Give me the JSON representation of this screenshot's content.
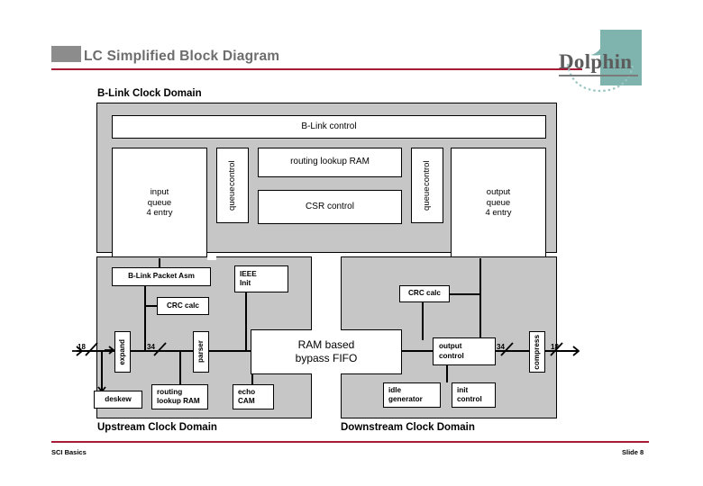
{
  "header": {
    "title": "LC Simplified Block Diagram",
    "bullet_color": "#8c8c8c",
    "rule_color": "#a81b37",
    "title_color": "#6d6d6d"
  },
  "logo": {
    "text": "Dolphin",
    "square_color": "#7fb3ae",
    "dolphin_icon": "dolphin-icon"
  },
  "diagram": {
    "blink_domain_label": "B-Link Clock Domain",
    "upstream_label": "Upstream Clock Domain",
    "downstream_label": "Downstream Clock Domain",
    "blocks": {
      "blink_control": "B-Link control",
      "input_queue": "input\nqueue\n4 entry",
      "input_queue_l1": "input",
      "input_queue_l2": "queue",
      "input_queue_l3": "4 entry",
      "queue_control_left": "queue\ncontrol",
      "queue_control_left_l1": "queue",
      "queue_control_left_l2": "control",
      "routing_lookup_ram_top": "routing lookup RAM",
      "csr_control": "CSR control",
      "queue_control_right_l1": "queue",
      "queue_control_right_l2": "control",
      "output_queue_l1": "output",
      "output_queue_l2": "queue",
      "output_queue_l3": "4 entry",
      "blink_packet_asm": "B-Link Packet Asm",
      "ieee_init_l1": "IEEE",
      "ieee_init_l2": "Init",
      "crc_calc_left": "CRC calc",
      "crc_calc_right": "CRC calc",
      "expand": "expand",
      "parser": "parser",
      "deskew": "deskew",
      "routing_lookup_ram_l1": "routing",
      "routing_lookup_ram_l2": "lookup RAM",
      "echo_cam_l1": "echo",
      "echo_cam_l2": "CAM",
      "bypass_fifo_l1": "RAM based",
      "bypass_fifo_l2": "bypass FIFO",
      "output_control_l1": "output",
      "output_control_l2": "control",
      "idle_generator_l1": "idle",
      "idle_generator_l2": "generator",
      "init_control_l1": "init",
      "init_control_l2": "control",
      "compress": "compress"
    },
    "bus_widths": {
      "in_left": "18",
      "after_expand": "34",
      "before_compress": "34",
      "out_right": "18"
    }
  },
  "footer": {
    "left": "SCI Basics",
    "right": "Slide 8"
  }
}
